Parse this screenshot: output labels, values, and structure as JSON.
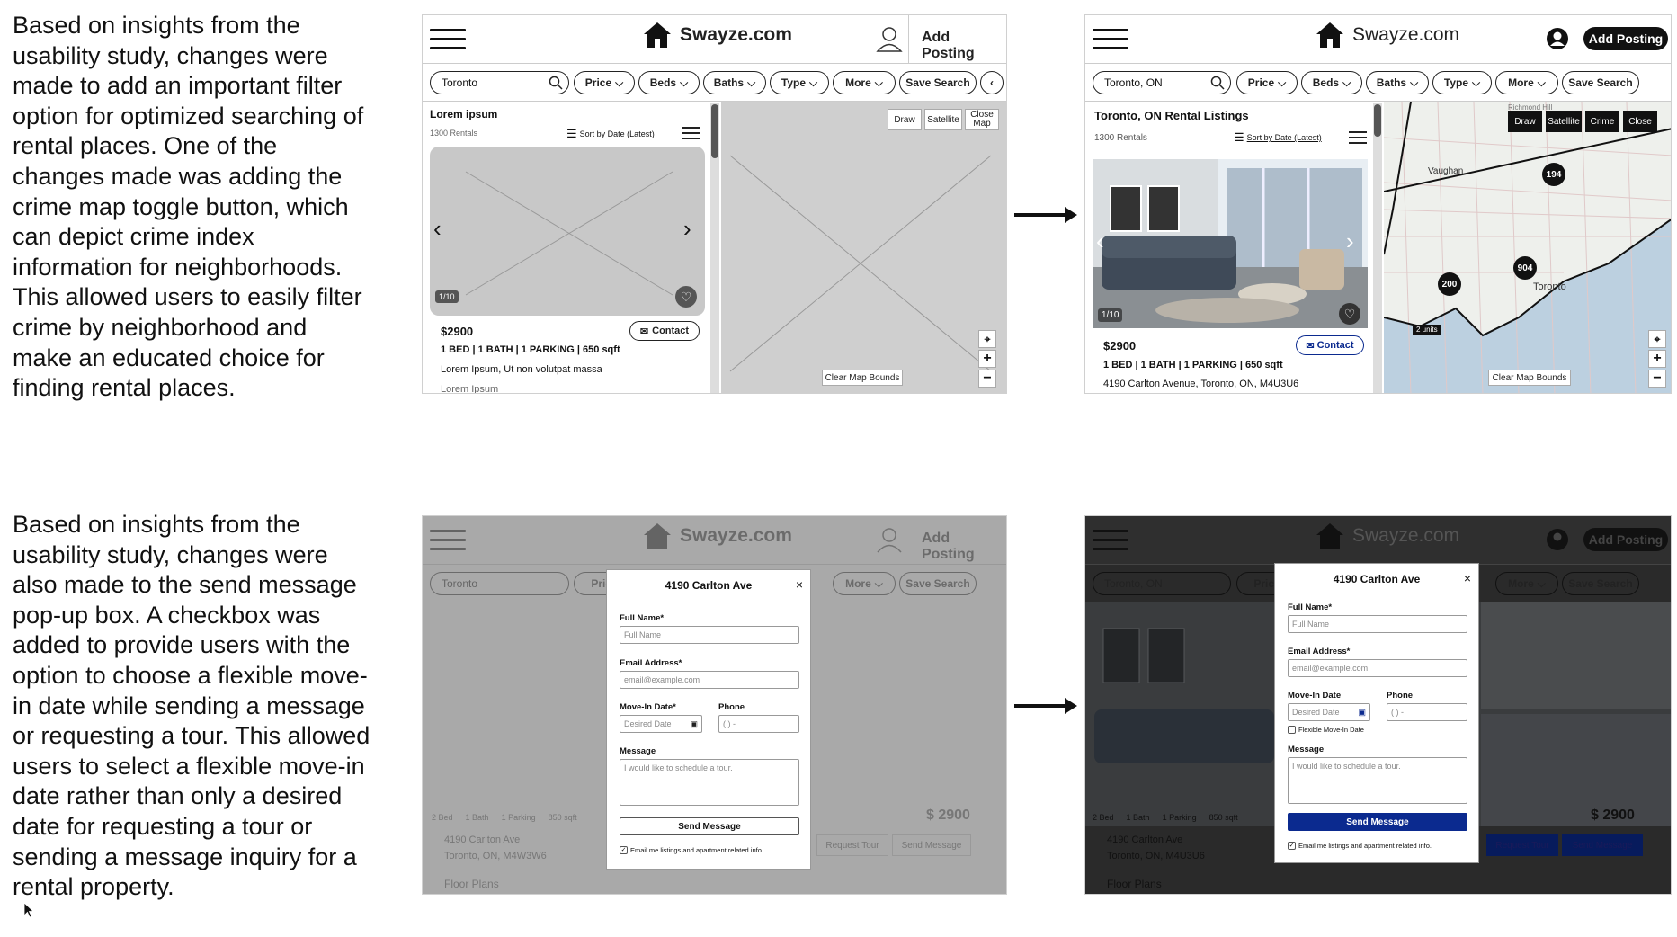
{
  "descriptions": {
    "top": [
      "Based on insights from the",
      "usability study, changes were",
      "made to add an important filter",
      "option for optimized searching of",
      "rental places. One of the",
      "changes made was adding the",
      "crime map toggle button, which",
      "can depict crime index",
      "information for neighborhoods.",
      "This allowed users to easily filter",
      "crime by neighborhood and",
      "make an educated choice for",
      "finding rental places."
    ],
    "bottom": [
      "Based on insights from the",
      "usability study, changes were",
      "also made to the send message",
      "pop-up box. A checkbox was",
      "added to provide users with the",
      "option to choose a flexible move-",
      "in date while sending a message",
      "or requesting a tour. This allowed",
      "users to select a flexible move-in",
      "date rather than only a desired",
      "date for requesting a tour or",
      "sending a message inquiry for a",
      "rental property."
    ]
  },
  "brand": "Swayze.com",
  "add_posting": "Add Posting",
  "filters": [
    "Price",
    "Beds",
    "Baths",
    "Type",
    "More"
  ],
  "save_search": "Save Search",
  "wire_top": {
    "search_value": "Toronto",
    "listing_title": "Lorem ipsum",
    "count": "1300 Rentals",
    "sort": "Sort by Date (Latest)",
    "photo_counter": "1/10",
    "price": "$2900",
    "contact": "Contact",
    "specs": [
      "1 BED",
      "1 BATH",
      "1 PARKING",
      "650 sqft"
    ],
    "desc": "Lorem Ipsum, Ut non volutpat massa",
    "desc2": "Lorem Ipsum",
    "map_buttons": [
      "Draw",
      "Satellite",
      "Close Map"
    ],
    "clear_bounds": "Clear Map Bounds"
  },
  "hifi_top": {
    "search_value": "Toronto, ON",
    "listing_title": "Toronto, ON Rental Listings",
    "count": "1300 Rentals",
    "sort": "Sort by Date (Latest)",
    "photo_counter": "1/10",
    "price": "$2900",
    "contact": "Contact",
    "specs": [
      "1 BED",
      "1 BATH",
      "1 PARKING",
      "650 sqft"
    ],
    "address": "4190 Carlton Avenue, Toronto, ON, M4U3U6",
    "map_buttons": [
      "Draw",
      "Satellite",
      "Crime",
      "Close"
    ],
    "clear_bounds": "Clear Map Bounds",
    "map_labels": {
      "richmond": "Richmond Hill",
      "vaughan": "Vaughan",
      "toronto": "Toronto",
      "units": "2 units"
    },
    "clusters": [
      "194",
      "904",
      "200"
    ]
  },
  "wire_bottom": {
    "search_value": "Toronto",
    "stats": [
      "2 Bed",
      "1 Bath",
      "1 Parking",
      "850 sqft"
    ],
    "address1": "4190 Carlton Ave",
    "address2": "Toronto, ON, M4W3W6",
    "price": "$ 2900",
    "request_tour": "Request Tour",
    "send_message": "Send Message",
    "floor_plans": "Floor Plans",
    "modal": {
      "title": "4190 Carlton Ave",
      "full_name_label": "Full Name*",
      "full_name_ph": "Full Name",
      "email_label": "Email Address*",
      "email_ph": "email@example.com",
      "movein_label": "Move-In Date*",
      "movein_ph": "Desired Date",
      "phone_label": "Phone",
      "phone_ph": "(  )  -",
      "message_label": "Message",
      "message_ph": "I would like to schedule a tour.",
      "send": "Send Message",
      "email_opt": "Email me listings and apartment related info."
    }
  },
  "hifi_bottom": {
    "search_value": "Toronto, ON",
    "stats": [
      "2 Bed",
      "1 Bath",
      "1 Parking",
      "850 sqft"
    ],
    "address1": "4190 Carlton Ave",
    "address2": "Toronto, ON, M4U3U6",
    "price": "$ 2900",
    "request_tour": "Request Tour",
    "send_message": "Send Message",
    "floor_plans": "Floor Plans",
    "modal": {
      "title": "4190 Carlton Ave",
      "full_name_label": "Full Name*",
      "full_name_ph": "Full Name",
      "email_label": "Email Address*",
      "email_ph": "email@example.com",
      "movein_label": "Move-In Date",
      "movein_ph": "Desired Date",
      "phone_label": "Phone",
      "phone_ph": "(  )  -",
      "flexible": "Flexible Move-In Date",
      "message_label": "Message",
      "message_ph": "I would like to schedule a tour.",
      "send": "Send Message",
      "email_opt": "Email me listings and apartment related info."
    }
  },
  "colors": {
    "accent_blue": "#0b2a8f",
    "wire_gray": "#c8c8c8",
    "map_land": "#eef0ec",
    "map_water": "#bcd0e0"
  }
}
